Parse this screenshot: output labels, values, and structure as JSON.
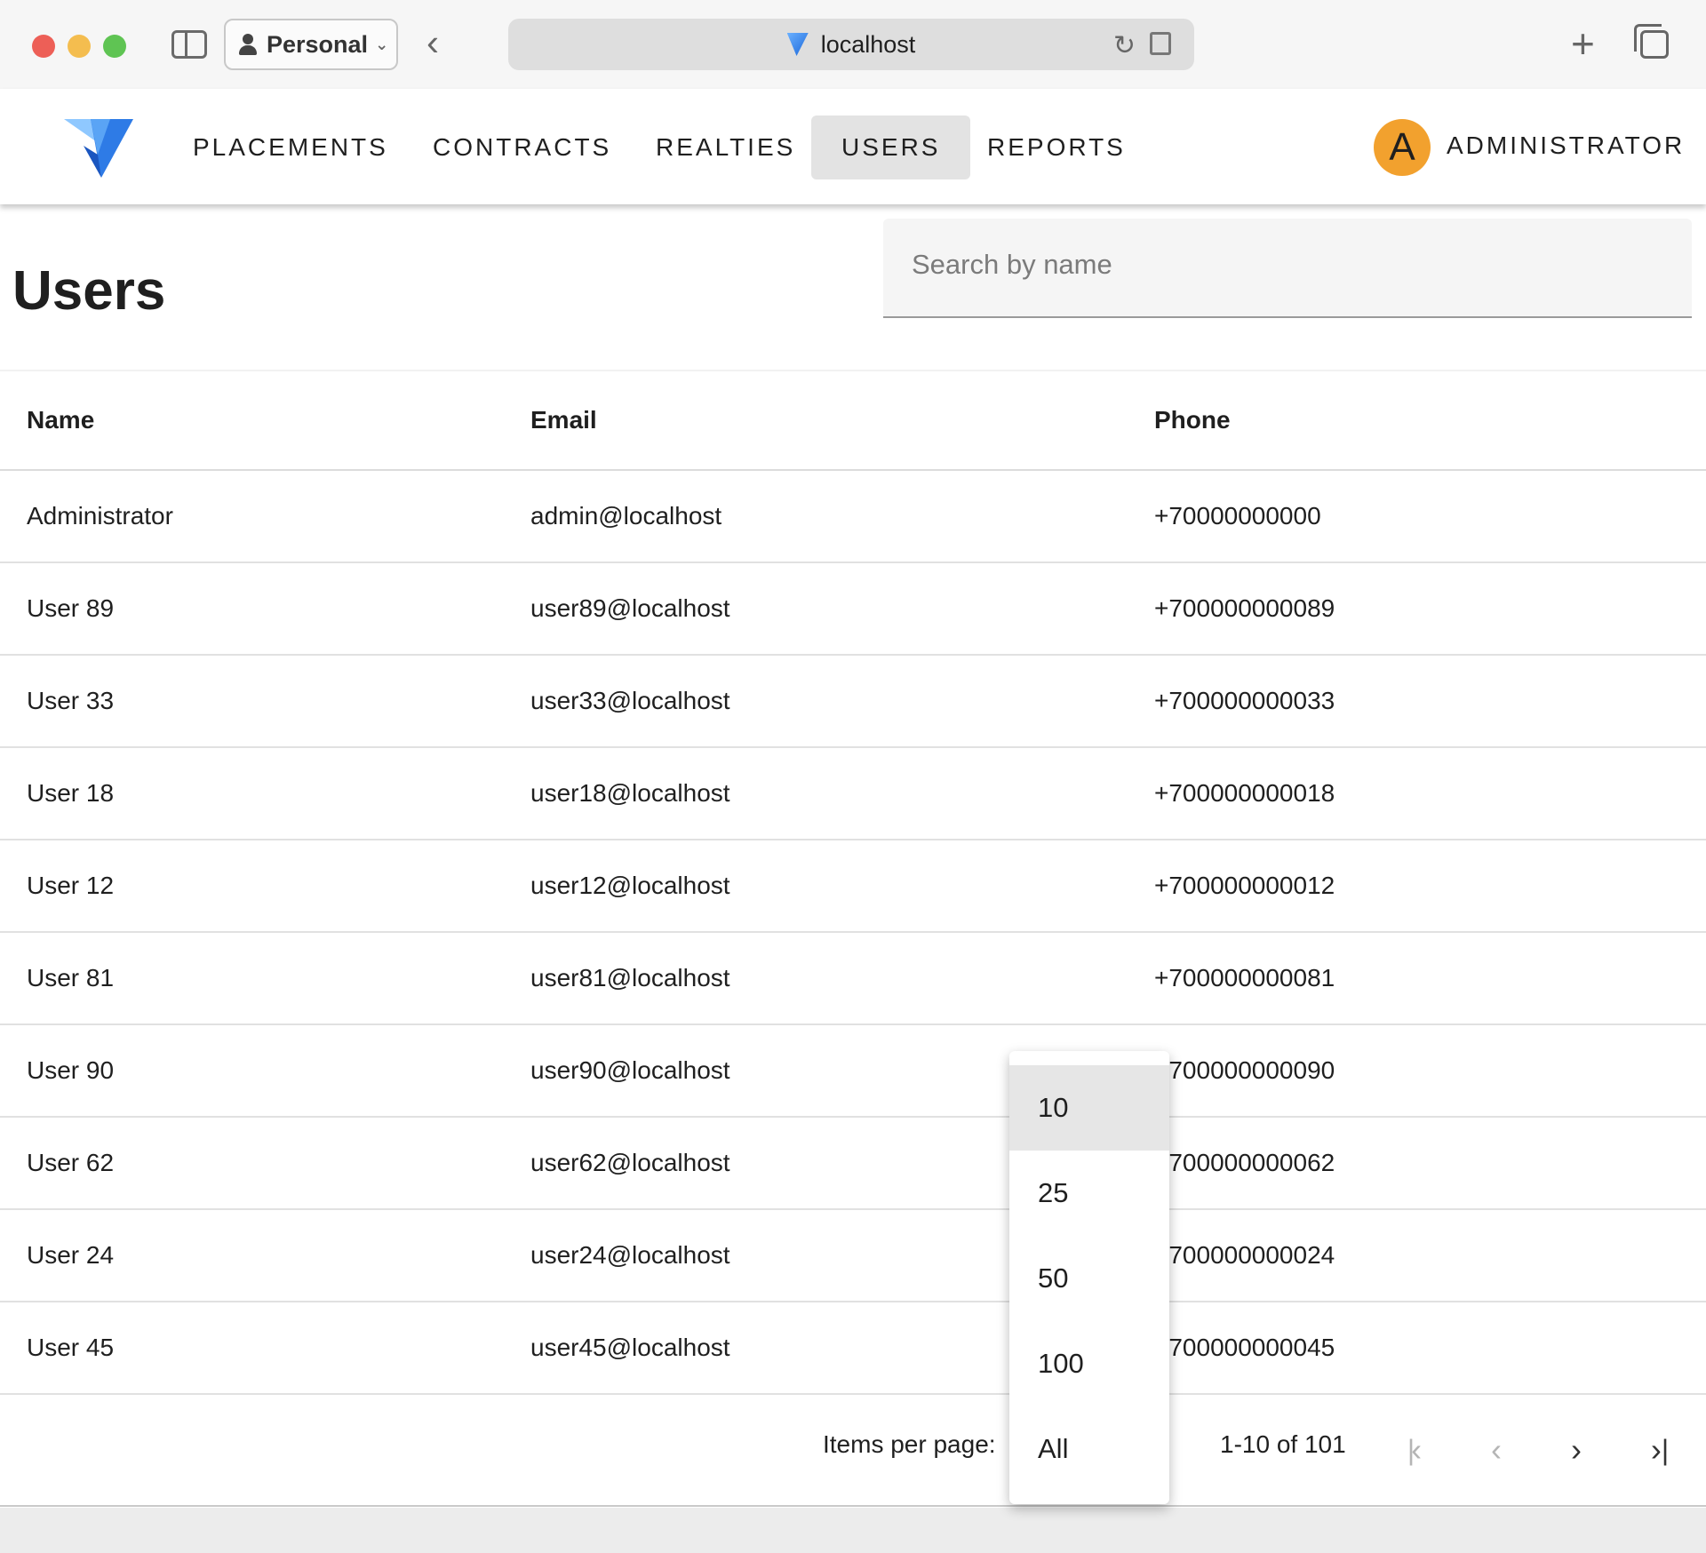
{
  "browser": {
    "profile_label": "Personal",
    "url": "localhost",
    "colors": {
      "close": "#ed5f57",
      "minimize": "#f4bd4f",
      "zoom": "#5fc453"
    }
  },
  "nav": {
    "items": [
      {
        "label": "PLACEMENTS",
        "active": false
      },
      {
        "label": "CONTRACTS",
        "active": false
      },
      {
        "label": "REALTIES",
        "active": false
      },
      {
        "label": "USERS",
        "active": true
      },
      {
        "label": "REPORTS",
        "active": false
      }
    ],
    "user": {
      "avatar_letter": "A",
      "name": "ADMINISTRATOR",
      "avatar_color": "#f2a12e"
    }
  },
  "page": {
    "title": "Users",
    "search_placeholder": "Search by name",
    "search_value": ""
  },
  "table": {
    "headers": {
      "name": "Name",
      "email": "Email",
      "phone": "Phone"
    },
    "rows": [
      {
        "name": "Administrator",
        "email": "admin@localhost",
        "phone": "+70000000000"
      },
      {
        "name": "User 89",
        "email": "user89@localhost",
        "phone": "+700000000089"
      },
      {
        "name": "User 33",
        "email": "user33@localhost",
        "phone": "+700000000033"
      },
      {
        "name": "User 18",
        "email": "user18@localhost",
        "phone": "+700000000018"
      },
      {
        "name": "User 12",
        "email": "user12@localhost",
        "phone": "+700000000012"
      },
      {
        "name": "User 81",
        "email": "user81@localhost",
        "phone": "+700000000081"
      },
      {
        "name": "User 90",
        "email": "user90@localhost",
        "phone": "+700000000090"
      },
      {
        "name": "User 62",
        "email": "user62@localhost",
        "phone": "+700000000062"
      },
      {
        "name": "User 24",
        "email": "user24@localhost",
        "phone": "+700000000024"
      },
      {
        "name": "User 45",
        "email": "user45@localhost",
        "phone": "+700000000045"
      }
    ]
  },
  "pagination": {
    "items_per_page_label": "Items per page:",
    "items_per_page_value": "10",
    "options": [
      "10",
      "25",
      "50",
      "100",
      "All"
    ],
    "range_text": "1-10 of 101"
  }
}
